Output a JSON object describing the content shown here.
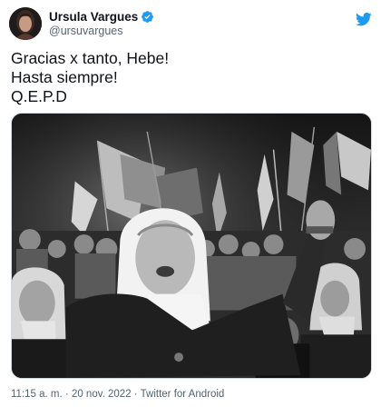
{
  "author": {
    "display_name": "Ursula Vargues",
    "handle": "@ursuvargues",
    "verified_icon": "verified-badge-icon",
    "verified_color": "#1d9bf0"
  },
  "tweet": {
    "lines": [
      "Gracias x tanto, Hebe!",
      "Hasta siempre!",
      "Q.E.P.D"
    ]
  },
  "media": {
    "type": "black-and-white photograph"
  },
  "meta": {
    "time": "11:15 a. m.",
    "separator": "·",
    "date": "20 nov. 2022",
    "source": "Twitter for Android"
  },
  "colors": {
    "text": "#0f1419",
    "secondary": "#536471",
    "twitter_blue": "#1d9bf0"
  }
}
